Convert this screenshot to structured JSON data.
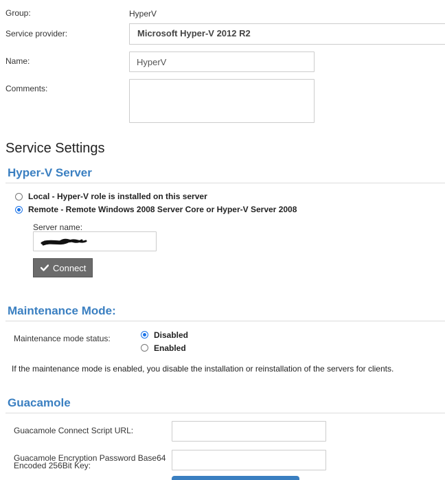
{
  "general": {
    "group_label": "Group:",
    "group_value": "HyperV",
    "provider_label": "Service provider:",
    "provider_value": "Microsoft Hyper-V 2012 R2",
    "name_label": "Name:",
    "name_value": "HyperV",
    "comments_label": "Comments:",
    "comments_value": ""
  },
  "service_settings": {
    "title": "Service Settings"
  },
  "hyperv_server": {
    "heading": "Hyper-V Server",
    "options": [
      {
        "label": "Local - Hyper-V role is installed on this server",
        "selected": false
      },
      {
        "label": "Remote - Remote Windows 2008 Server Core or Hyper-V Server 2008",
        "selected": true
      }
    ],
    "server_name_label": "Server name:",
    "connect_label": "Connect",
    "connect_icon": "check-icon"
  },
  "maintenance": {
    "heading": "Maintenance Mode:",
    "status_label": "Maintenance mode status:",
    "options": [
      {
        "label": "Disabled",
        "selected": true
      },
      {
        "label": "Enabled",
        "selected": false
      }
    ],
    "note": "If the maintenance mode is enabled, you disable the installation or reinstallation of the servers for clients."
  },
  "guacamole": {
    "heading": "Guacamole",
    "script_url_label": "Guacamole Connect Script URL:",
    "script_url_value": "",
    "key_label_line1": "Guacamole Encryption Password Base64",
    "key_label_line2": "Encoded 256Bit Key:",
    "key_value": ""
  },
  "colors": {
    "section_heading": "#3a7fc1",
    "radio_selected": "#1a73e8",
    "connect_button": "#6b6b6b"
  }
}
